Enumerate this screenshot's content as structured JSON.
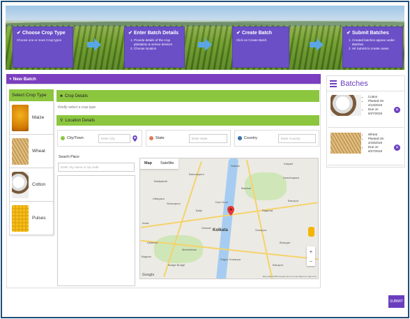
{
  "hero": {
    "steps": [
      {
        "title": "Choose Crop Type",
        "desc": "Choose one or more Crop types"
      },
      {
        "title": "Enter Batch Details",
        "items": [
          "Provide details of the crop plantation & sensor devices",
          "Choose location"
        ]
      },
      {
        "title": "Create Batch",
        "desc": "Click on Create Batch"
      },
      {
        "title": "Submit Batches",
        "items": [
          "Created batches appear under Batches",
          "Hit Submit to create cases"
        ]
      }
    ]
  },
  "new_batch": {
    "label": "+ New Batch"
  },
  "crop_panel": {
    "header": "Select Crop Type",
    "items": [
      {
        "label": "Maize",
        "icon": "maize-image"
      },
      {
        "label": "Wheat",
        "icon": "wheat-image"
      },
      {
        "label": "Cotton",
        "icon": "cotton-image"
      },
      {
        "label": "Pulses",
        "icon": "pulses-image"
      }
    ]
  },
  "crop_details": {
    "title": "Crop Details",
    "hint": "Kindly select a crop type"
  },
  "location": {
    "title": "Location Details",
    "city": {
      "label": "City/Town",
      "placeholder": "Enter City"
    },
    "state": {
      "label": "State",
      "placeholder": "Enter State"
    },
    "country": {
      "label": "Country",
      "placeholder": "Enter Country"
    },
    "search_label": "Search Place",
    "search_placeholder": "Enter city name or zip code"
  },
  "map": {
    "tabs": [
      "Map",
      "Satellite"
    ],
    "city_label": "Kolkata",
    "towns": [
      "Barrackpore",
      "Barasat",
      "Sonarpur",
      "Howrah",
      "Rajpur Sonarpur",
      "Baruipur",
      "Dum Dum",
      "Bally",
      "Uttarpara",
      "Baidyabati",
      "Serampore",
      "Naihati",
      "Kalyani",
      "Budge Budge",
      "Maheshtala",
      "Rajarhat",
      "Bhangar",
      "Kanchrapara",
      "Bagnan",
      "Uluberia",
      "Baruipur",
      "Amta"
    ],
    "zoom_in": "+",
    "zoom_out": "−",
    "footer": "Map data ©2019 Google   Terms of Use   Report a map error",
    "google": "Google"
  },
  "batches": {
    "title": "Batches",
    "items": [
      {
        "crop": "Cotton",
        "planted_label": "Planted On",
        "planted": "4/13/2019",
        "due_label": "Due on",
        "due": "6/27/2019"
      },
      {
        "crop": "Wheat",
        "planted_label": "Planted On",
        "planted": "4/19/2019",
        "due_label": "Due on",
        "due": "6/27/2019"
      }
    ]
  },
  "submit_label": "SUBMIT",
  "colors": {
    "purple": "#6a3fbf",
    "green": "#8cc63f",
    "arrow": "#5aa6e4"
  }
}
